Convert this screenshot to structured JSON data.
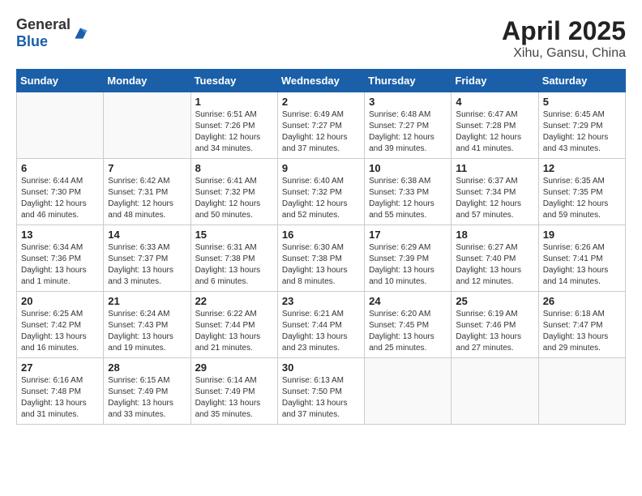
{
  "header": {
    "logo_general": "General",
    "logo_blue": "Blue",
    "title": "April 2025",
    "subtitle": "Xihu, Gansu, China"
  },
  "calendar": {
    "days_of_week": [
      "Sunday",
      "Monday",
      "Tuesday",
      "Wednesday",
      "Thursday",
      "Friday",
      "Saturday"
    ],
    "weeks": [
      [
        {
          "day": "",
          "info": ""
        },
        {
          "day": "",
          "info": ""
        },
        {
          "day": "1",
          "info": "Sunrise: 6:51 AM\nSunset: 7:26 PM\nDaylight: 12 hours and 34 minutes."
        },
        {
          "day": "2",
          "info": "Sunrise: 6:49 AM\nSunset: 7:27 PM\nDaylight: 12 hours and 37 minutes."
        },
        {
          "day": "3",
          "info": "Sunrise: 6:48 AM\nSunset: 7:27 PM\nDaylight: 12 hours and 39 minutes."
        },
        {
          "day": "4",
          "info": "Sunrise: 6:47 AM\nSunset: 7:28 PM\nDaylight: 12 hours and 41 minutes."
        },
        {
          "day": "5",
          "info": "Sunrise: 6:45 AM\nSunset: 7:29 PM\nDaylight: 12 hours and 43 minutes."
        }
      ],
      [
        {
          "day": "6",
          "info": "Sunrise: 6:44 AM\nSunset: 7:30 PM\nDaylight: 12 hours and 46 minutes."
        },
        {
          "day": "7",
          "info": "Sunrise: 6:42 AM\nSunset: 7:31 PM\nDaylight: 12 hours and 48 minutes."
        },
        {
          "day": "8",
          "info": "Sunrise: 6:41 AM\nSunset: 7:32 PM\nDaylight: 12 hours and 50 minutes."
        },
        {
          "day": "9",
          "info": "Sunrise: 6:40 AM\nSunset: 7:32 PM\nDaylight: 12 hours and 52 minutes."
        },
        {
          "day": "10",
          "info": "Sunrise: 6:38 AM\nSunset: 7:33 PM\nDaylight: 12 hours and 55 minutes."
        },
        {
          "day": "11",
          "info": "Sunrise: 6:37 AM\nSunset: 7:34 PM\nDaylight: 12 hours and 57 minutes."
        },
        {
          "day": "12",
          "info": "Sunrise: 6:35 AM\nSunset: 7:35 PM\nDaylight: 12 hours and 59 minutes."
        }
      ],
      [
        {
          "day": "13",
          "info": "Sunrise: 6:34 AM\nSunset: 7:36 PM\nDaylight: 13 hours and 1 minute."
        },
        {
          "day": "14",
          "info": "Sunrise: 6:33 AM\nSunset: 7:37 PM\nDaylight: 13 hours and 3 minutes."
        },
        {
          "day": "15",
          "info": "Sunrise: 6:31 AM\nSunset: 7:38 PM\nDaylight: 13 hours and 6 minutes."
        },
        {
          "day": "16",
          "info": "Sunrise: 6:30 AM\nSunset: 7:38 PM\nDaylight: 13 hours and 8 minutes."
        },
        {
          "day": "17",
          "info": "Sunrise: 6:29 AM\nSunset: 7:39 PM\nDaylight: 13 hours and 10 minutes."
        },
        {
          "day": "18",
          "info": "Sunrise: 6:27 AM\nSunset: 7:40 PM\nDaylight: 13 hours and 12 minutes."
        },
        {
          "day": "19",
          "info": "Sunrise: 6:26 AM\nSunset: 7:41 PM\nDaylight: 13 hours and 14 minutes."
        }
      ],
      [
        {
          "day": "20",
          "info": "Sunrise: 6:25 AM\nSunset: 7:42 PM\nDaylight: 13 hours and 16 minutes."
        },
        {
          "day": "21",
          "info": "Sunrise: 6:24 AM\nSunset: 7:43 PM\nDaylight: 13 hours and 19 minutes."
        },
        {
          "day": "22",
          "info": "Sunrise: 6:22 AM\nSunset: 7:44 PM\nDaylight: 13 hours and 21 minutes."
        },
        {
          "day": "23",
          "info": "Sunrise: 6:21 AM\nSunset: 7:44 PM\nDaylight: 13 hours and 23 minutes."
        },
        {
          "day": "24",
          "info": "Sunrise: 6:20 AM\nSunset: 7:45 PM\nDaylight: 13 hours and 25 minutes."
        },
        {
          "day": "25",
          "info": "Sunrise: 6:19 AM\nSunset: 7:46 PM\nDaylight: 13 hours and 27 minutes."
        },
        {
          "day": "26",
          "info": "Sunrise: 6:18 AM\nSunset: 7:47 PM\nDaylight: 13 hours and 29 minutes."
        }
      ],
      [
        {
          "day": "27",
          "info": "Sunrise: 6:16 AM\nSunset: 7:48 PM\nDaylight: 13 hours and 31 minutes."
        },
        {
          "day": "28",
          "info": "Sunrise: 6:15 AM\nSunset: 7:49 PM\nDaylight: 13 hours and 33 minutes."
        },
        {
          "day": "29",
          "info": "Sunrise: 6:14 AM\nSunset: 7:49 PM\nDaylight: 13 hours and 35 minutes."
        },
        {
          "day": "30",
          "info": "Sunrise: 6:13 AM\nSunset: 7:50 PM\nDaylight: 13 hours and 37 minutes."
        },
        {
          "day": "",
          "info": ""
        },
        {
          "day": "",
          "info": ""
        },
        {
          "day": "",
          "info": ""
        }
      ]
    ]
  }
}
